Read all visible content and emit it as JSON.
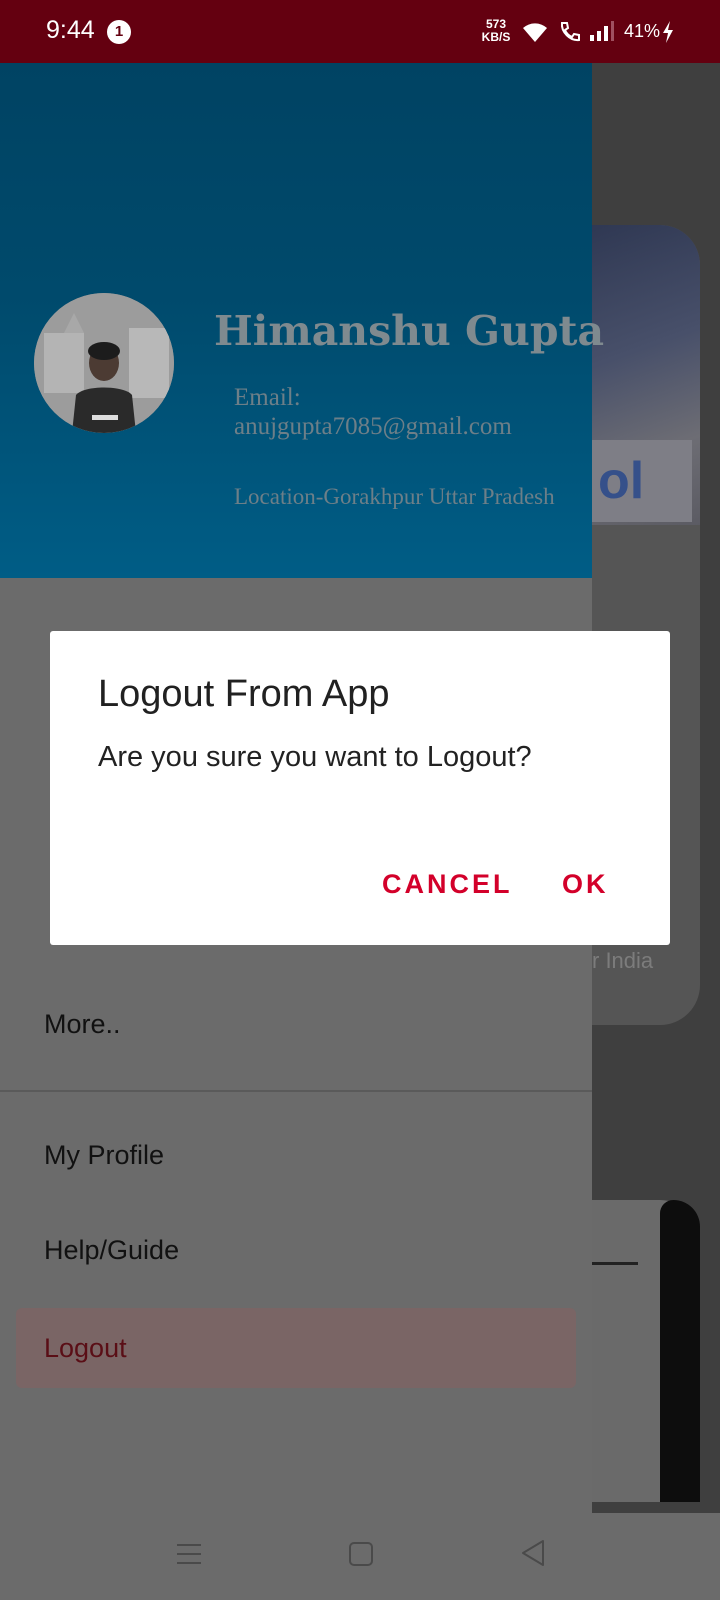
{
  "status_bar": {
    "time": "9:44",
    "notification_count": "1",
    "net_speed_value": "573",
    "net_speed_unit": "KB/S",
    "battery": "41%",
    "wifi_icon": "wifi-icon",
    "call_icon": "wifi-call-icon",
    "signal_icon": "signal-icon",
    "charge_icon": "charging-icon"
  },
  "drawer": {
    "header": {
      "name": "Himanshu Gupta",
      "email": "Email: anujgupta7085@gmail.com",
      "location": "Location-Gorakhpur Uttar Pradesh"
    },
    "items": [
      {
        "label": "More.."
      }
    ],
    "secondary_items": [
      {
        "label": "My Profile"
      },
      {
        "label": "Help/Guide"
      },
      {
        "label": "Logout"
      }
    ]
  },
  "background": {
    "card_caption_fragment": "r India",
    "card_logo_fragment": "ol"
  },
  "dialog": {
    "title": "Logout From App",
    "message": "Are you sure you want to Logout?",
    "cancel_label": "CANCEL",
    "ok_label": "OK"
  },
  "colors": {
    "status_bar": "#640010",
    "drawer_header": "#004a6c",
    "accent": "#d3002a",
    "scrim": "#6b6b6b"
  }
}
